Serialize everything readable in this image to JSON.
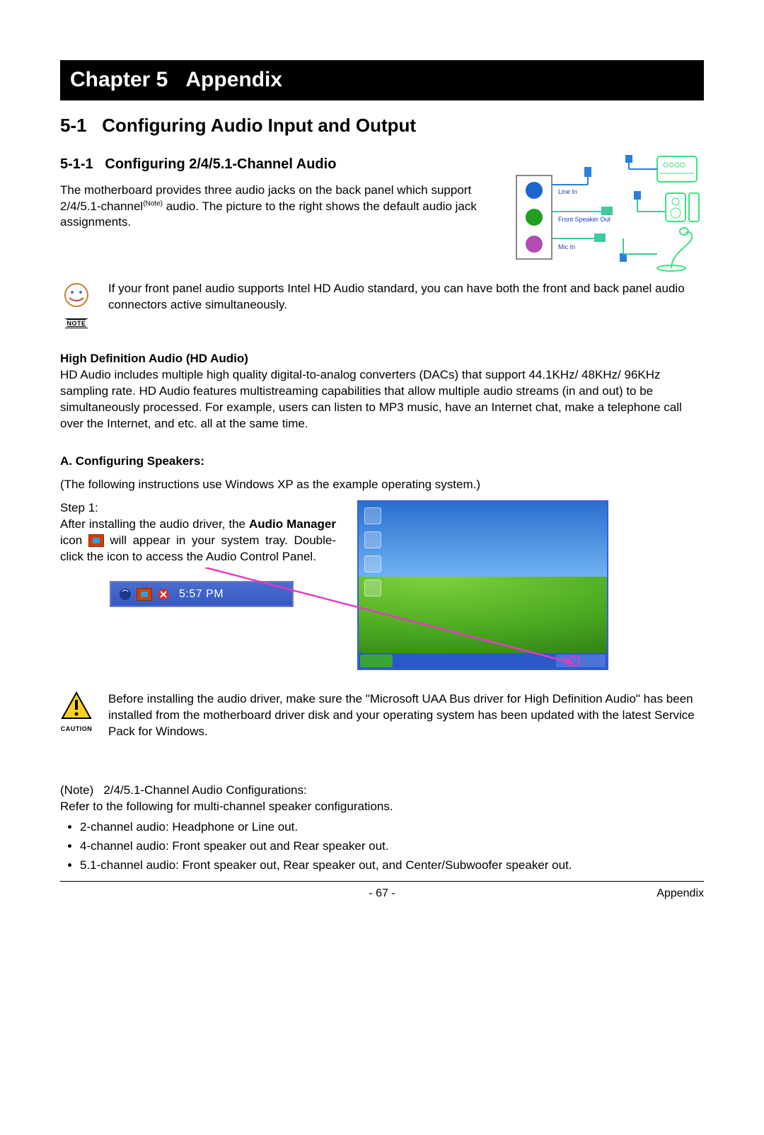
{
  "chapter": {
    "label": "Chapter 5",
    "title": "Appendix"
  },
  "h1": {
    "num": "5-1",
    "title": "Configuring Audio Input and Output"
  },
  "h2": {
    "num": "5-1-1",
    "title": "Configuring 2/4/5.1-Channel Audio"
  },
  "intro": {
    "p1a": "The motherboard provides three audio jacks on the back panel which support 2/4/5.1-channel",
    "p1b": " audio. The picture to the right shows the default audio jack assignments.",
    "note_sup": "(Note)"
  },
  "jacks": {
    "line_in": "Line In",
    "front_out": "Front Speaker Out",
    "mic_in": "Mic In"
  },
  "note": {
    "label": "NOTE",
    "text": "If your front panel audio supports Intel HD Audio standard, you can have both the front and back panel audio connectors active simultaneously."
  },
  "hd": {
    "heading": "High Definition Audio (HD Audio)",
    "text": "HD Audio includes multiple high quality digital-to-analog converters (DACs) that support 44.1KHz/ 48KHz/ 96KHz sampling rate. HD Audio features multistreaming capabilities that allow multiple audio streams (in and out) to be simultaneously processed. For example, users can listen to MP3 music, have an Internet chat, make a telephone call over the Internet, and etc. all at the same time."
  },
  "cfg": {
    "heading": "A. Configuring Speakers:",
    "hint": "(The following instructions use Windows XP as the example operating system.)",
    "step_label": "Step 1:",
    "step1a": "After installing the audio driver, the ",
    "step1b": "Audio Manager",
    "step1c": " icon ",
    "step1d": " will appear in your system tray. Double-click the icon to access the Audio Control Panel."
  },
  "tray": {
    "time": "5:57 PM"
  },
  "caution": {
    "label": "CAUTION",
    "text": "Before installing the audio driver, make sure the \"Microsoft UAA Bus driver for High Definition Audio\" has been installed from the motherboard driver disk and your operating system has been updated with the latest Service Pack for Windows."
  },
  "footnote": {
    "label": "(Note)",
    "title": "2/4/5.1-Channel Audio Configurations:",
    "lead": "Refer to the following for multi-channel speaker configurations.",
    "items": [
      "2-channel audio: Headphone or Line out.",
      "4-channel audio: Front speaker out and Rear speaker out.",
      "5.1-channel audio: Front speaker out, Rear speaker out, and Center/Subwoofer speaker out."
    ]
  },
  "footer": {
    "page": "- 67 -",
    "section": "Appendix"
  }
}
